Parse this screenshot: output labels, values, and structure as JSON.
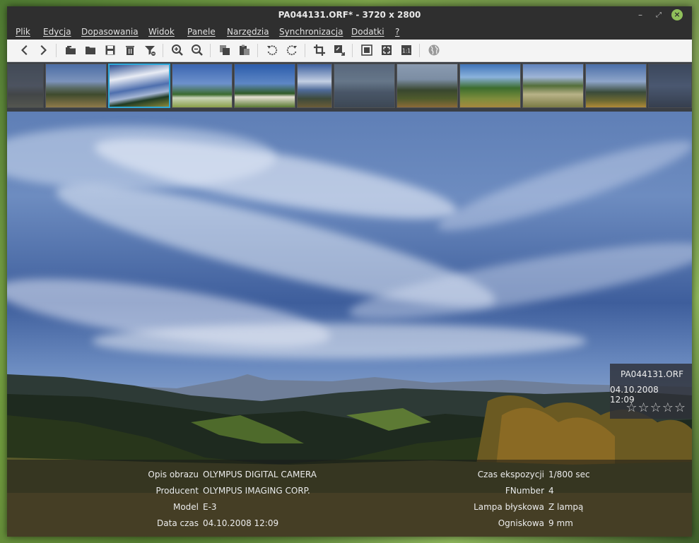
{
  "window": {
    "title": "PA044131.ORF* - 3720 x 2800",
    "minimize_glyph": "–",
    "maximize_glyph": "⤢",
    "close_glyph": "×"
  },
  "menu": [
    {
      "label": "Plik"
    },
    {
      "label": "Edycja"
    },
    {
      "label": "Dopasowania"
    },
    {
      "label": "Widok"
    },
    {
      "label": "Panele"
    },
    {
      "label": "Narzędzia"
    },
    {
      "label": "Synchronizacja"
    },
    {
      "label": "Dodatki"
    },
    {
      "label": "?"
    }
  ],
  "toolbar": [
    {
      "name": "previous-icon"
    },
    {
      "name": "next-icon"
    },
    {
      "name": "open-file-icon"
    },
    {
      "name": "open-folder-icon"
    },
    {
      "name": "save-icon"
    },
    {
      "name": "delete-icon"
    },
    {
      "name": "filter-icon"
    },
    {
      "name": "zoom-in-icon"
    },
    {
      "name": "zoom-out-icon"
    },
    {
      "name": "copy-icon"
    },
    {
      "name": "paste-icon"
    },
    {
      "name": "rotate-left-icon"
    },
    {
      "name": "rotate-right-icon"
    },
    {
      "name": "crop-icon"
    },
    {
      "name": "resize-icon"
    },
    {
      "name": "fit-window-icon"
    },
    {
      "name": "fullscreen-icon"
    },
    {
      "name": "actual-size-icon"
    },
    {
      "name": "globe-icon"
    }
  ],
  "toolbar_actual_size_label": "1:1",
  "filmstrip": {
    "selected_index": 2,
    "count": 11
  },
  "overlay": {
    "filename": "PA044131.ORF",
    "datetime": "04.10.2008 12:09",
    "rating": 0,
    "rating_max": 5,
    "stars": "☆☆☆☆☆"
  },
  "exif": {
    "left": [
      {
        "label": "Opis obrazu",
        "value": "OLYMPUS DIGITAL CAMERA"
      },
      {
        "label": "Producent",
        "value": "OLYMPUS IMAGING CORP."
      },
      {
        "label": "Model",
        "value": "E-3"
      },
      {
        "label": "Data czas",
        "value": "04.10.2008 12:09"
      }
    ],
    "right": [
      {
        "label": "Czas ekspozycji",
        "value": "1/800 sec"
      },
      {
        "label": "FNumber",
        "value": "4"
      },
      {
        "label": "Lampa błyskowa",
        "value": "Z lampą"
      },
      {
        "label": "Ogniskowa",
        "value": "9 mm"
      }
    ]
  },
  "colors": {
    "selection": "#2fa8d8",
    "titlebar": "#2f2f2f",
    "toolbar": "#f4f4f4"
  }
}
